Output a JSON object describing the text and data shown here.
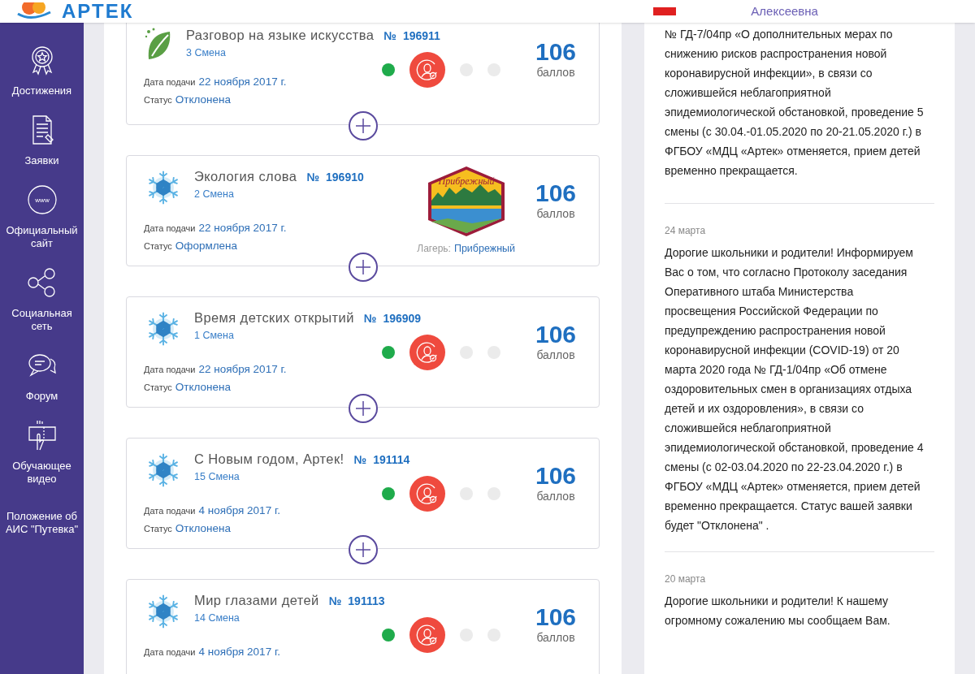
{
  "header": {
    "logo": "АРТЕК",
    "user_name": "Алексеевна"
  },
  "sidebar": {
    "items": [
      {
        "kind": "medal",
        "label": "Достижения"
      },
      {
        "kind": "document",
        "label": "Заявки"
      },
      {
        "kind": "www",
        "label": "Официальный сайт"
      },
      {
        "kind": "network",
        "label": "Социальная сеть"
      },
      {
        "kind": "chat",
        "label": "Форум"
      },
      {
        "kind": "touch",
        "label": "Обучающее видео"
      },
      {
        "kind": "text",
        "label": "Положение об АИС \"Путевка\""
      }
    ]
  },
  "applications": [
    {
      "kind": "leaf",
      "title": "Разговор на языке искусства",
      "number_label": "№",
      "number": "196911",
      "shift": "3 Смена",
      "date_label": "Дата подачи",
      "date": "22 ноября 2017 г.",
      "status_label": "Статус",
      "status": "Отклонена",
      "stages": [
        {
          "kind": "done"
        },
        {
          "kind": "current"
        },
        {
          "kind": "pending"
        },
        {
          "kind": "pending"
        }
      ],
      "score": "106",
      "score_unit": "баллов"
    },
    {
      "kind": "snowflake",
      "title": "Экология слова",
      "number_label": "№",
      "number": "196910",
      "shift": "2 Смена",
      "date_label": "Дата подачи",
      "date": "22 ноября 2017 г.",
      "status_label": "Статус",
      "status": "Оформлена",
      "camp_badge": "Прибрежный",
      "camp_label": "Лагерь:",
      "camp": "Прибрежный",
      "score": "106",
      "score_unit": "баллов"
    },
    {
      "kind": "snowflake",
      "title": "Время детских открытий",
      "number_label": "№",
      "number": "196909",
      "shift": "1 Смена",
      "date_label": "Дата подачи",
      "date": "22 ноября 2017 г.",
      "status_label": "Статус",
      "status": "Отклонена",
      "stages": [
        {
          "kind": "done"
        },
        {
          "kind": "current"
        },
        {
          "kind": "pending"
        },
        {
          "kind": "pending"
        }
      ],
      "score": "106",
      "score_unit": "баллов"
    },
    {
      "kind": "snowflake",
      "title": "С Новым годом, Артек!",
      "number_label": "№",
      "number": "191114",
      "shift": "15 Смена",
      "date_label": "Дата подачи",
      "date": "4 ноября 2017 г.",
      "status_label": "Статус",
      "status": "Отклонена",
      "stages": [
        {
          "kind": "done"
        },
        {
          "kind": "current"
        },
        {
          "kind": "pending"
        },
        {
          "kind": "pending"
        }
      ],
      "score": "106",
      "score_unit": "баллов"
    },
    {
      "kind": "snowflake",
      "title": "Мир глазами детей",
      "number_label": "№",
      "number": "191113",
      "shift": "14 Смена",
      "date_label": "Дата подачи",
      "date": "4 ноября 2017 г.",
      "stages": [
        {
          "kind": "done"
        },
        {
          "kind": "current"
        },
        {
          "kind": "pending"
        },
        {
          "kind": "pending"
        }
      ],
      "score": "106",
      "score_unit": "баллов"
    }
  ],
  "news": [
    {
      "text": "№ ГД-7/04пр «О дополнительных мерах по снижению рисков распространения новой коронавирусной инфекции», в связи со сложившейся неблагоприятной эпидемиологической обстановкой, проведение 5 смены (с 30.04.-01.05.2020 по 20-21.05.2020 г.) в ФГБОУ «МДЦ «Артек» отменяется, прием детей временно прекращается."
    },
    {
      "date": "24 марта",
      "text": "Дорогие школьники и родители! Информируем Вас о том, что согласно Протоколу заседания Оперативного штаба Министерства просвещения Российской Федерации по предупреждению распространения новой коронавирусной инфекции (COVID-19) от 20 марта 2020 года № ГД-1/04пр «Об отмене оздоровительных смен в организациях отдыха детей и их оздоровления», в связи со сложившейся неблагоприятной эпидемиологической обстановкой, проведение 4 смены (с 02-03.04.2020 по 22-23.04.2020 г.) в ФГБОУ «МДЦ «Артек» отменяется, прием детей временно прекращается. Статус вашей заявки будет \"Отклонена\" ."
    },
    {
      "date": "20 марта",
      "text": "Дорогие школьники и родители! К нашему огромному сожалению мы сообщаем Вам."
    }
  ]
}
